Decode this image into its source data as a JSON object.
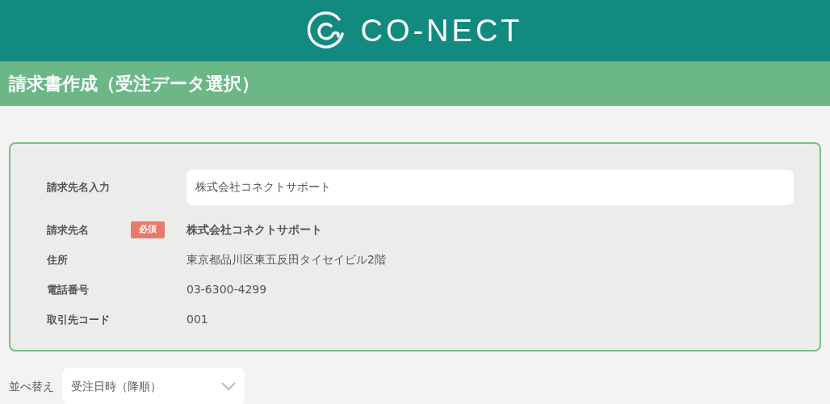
{
  "header": {
    "logo_text": "CO-NECT"
  },
  "page_title": "請求書作成（受注データ選択）",
  "billing_form": {
    "rows": [
      {
        "kind": "input",
        "label": "請求先名入力",
        "value": "株式会社コネクトサポート"
      },
      {
        "kind": "required",
        "label": "請求先名",
        "badge": "必須",
        "value": "株式会社コネクトサポート"
      },
      {
        "kind": "text",
        "label": "住所",
        "value": "東京都品川区東五反田タイセイビル2階"
      },
      {
        "kind": "text",
        "label": "電話番号",
        "value": "03-6300-4299"
      },
      {
        "kind": "text",
        "label": "取引先コード",
        "value": "001"
      }
    ]
  },
  "sort": {
    "label": "並べ替え",
    "value": "受注日時（降順）"
  }
}
